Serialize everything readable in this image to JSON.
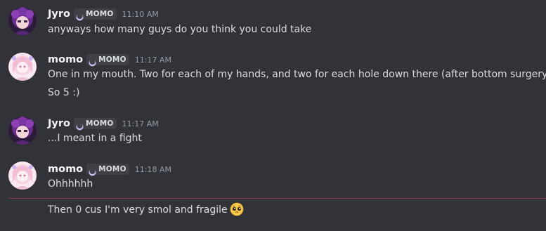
{
  "messages": [
    {
      "username": "Jyro",
      "tag": "MOMO",
      "timestamp": "11:10 AM",
      "lines": [
        "anyways how many guys do you think you could take"
      ]
    },
    {
      "username": "momo",
      "tag": "MOMO",
      "timestamp": "11:17 AM",
      "lines": [
        "One in my mouth. Two for each of my hands, and two for each hole down there (after bottom surgery)",
        "So 5 :)"
      ]
    },
    {
      "username": "Jyro",
      "tag": "MOMO",
      "timestamp": "11:17 AM",
      "lines": [
        "...I meant in a fight"
      ]
    },
    {
      "username": "momo",
      "tag": "MOMO",
      "timestamp": "11:18 AM",
      "lines": [
        "Ohhhhhh"
      ]
    }
  ],
  "followup": {
    "text": "Then 0 cus I'm very smol and fragile",
    "emoji": "pleading-face-emoji"
  },
  "colors": {
    "background": "#313338",
    "username": "#f2f3f5",
    "text": "#dbdee1",
    "timestamp": "#949ba4",
    "tag_bg": "#3f4147",
    "new_divider": "#8c3a44"
  }
}
